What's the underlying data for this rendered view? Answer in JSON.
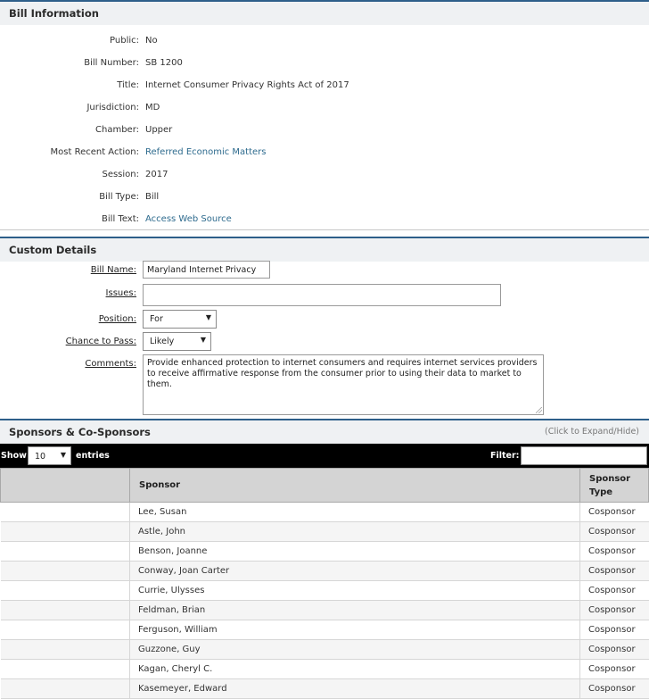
{
  "bill_info": {
    "title": "Bill Information",
    "rows": [
      {
        "label": "Public:",
        "value": "No"
      },
      {
        "label": "Bill Number:",
        "value": "SB 1200"
      },
      {
        "label": "Title:",
        "value": "Internet Consumer Privacy Rights Act of 2017"
      },
      {
        "label": "Jurisdiction:",
        "value": "MD"
      },
      {
        "label": "Chamber:",
        "value": "Upper"
      },
      {
        "label": "Most Recent Action:",
        "value": "Referred Economic Matters"
      },
      {
        "label": "Session:",
        "value": "2017"
      },
      {
        "label": "Bill Type:",
        "value": "Bill"
      },
      {
        "label": "Bill Text:",
        "value": "Access Web Source"
      }
    ]
  },
  "custom_details": {
    "title": "Custom Details",
    "bill_name_label": "Bill Name:",
    "bill_name_value": "Maryland Internet Privacy",
    "issues_label": "Issues:",
    "issues_value": "",
    "position_label": "Position:",
    "position_value": "For",
    "chance_label": "Chance to Pass:",
    "chance_value": "Likely",
    "comments_label": "Comments:",
    "comments_value": "Provide enhanced protection to internet consumers and requires internet services providers to receive affirmative response from the consumer prior to using their data to market to them."
  },
  "sponsors": {
    "title": "Sponsors & Co-Sponsors",
    "hint": "(Click to Expand/Hide)",
    "show_label": "Show",
    "page_length": "10",
    "entries_label": "entries",
    "filter_label": "Filter:",
    "columns": [
      "",
      "Sponsor",
      "Sponsor Type"
    ],
    "rows": [
      {
        "sponsor": "Lee, Susan",
        "type": "Cosponsor"
      },
      {
        "sponsor": "Astle, John",
        "type": "Cosponsor"
      },
      {
        "sponsor": "Benson, Joanne",
        "type": "Cosponsor"
      },
      {
        "sponsor": "Conway, Joan Carter",
        "type": "Cosponsor"
      },
      {
        "sponsor": "Currie, Ulysses",
        "type": "Cosponsor"
      },
      {
        "sponsor": "Feldman, Brian",
        "type": "Cosponsor"
      },
      {
        "sponsor": "Ferguson, William",
        "type": "Cosponsor"
      },
      {
        "sponsor": "Guzzone, Guy",
        "type": "Cosponsor"
      },
      {
        "sponsor": "Kagan, Cheryl C.",
        "type": "Cosponsor"
      },
      {
        "sponsor": "Kasemeyer, Edward",
        "type": "Cosponsor"
      }
    ]
  }
}
